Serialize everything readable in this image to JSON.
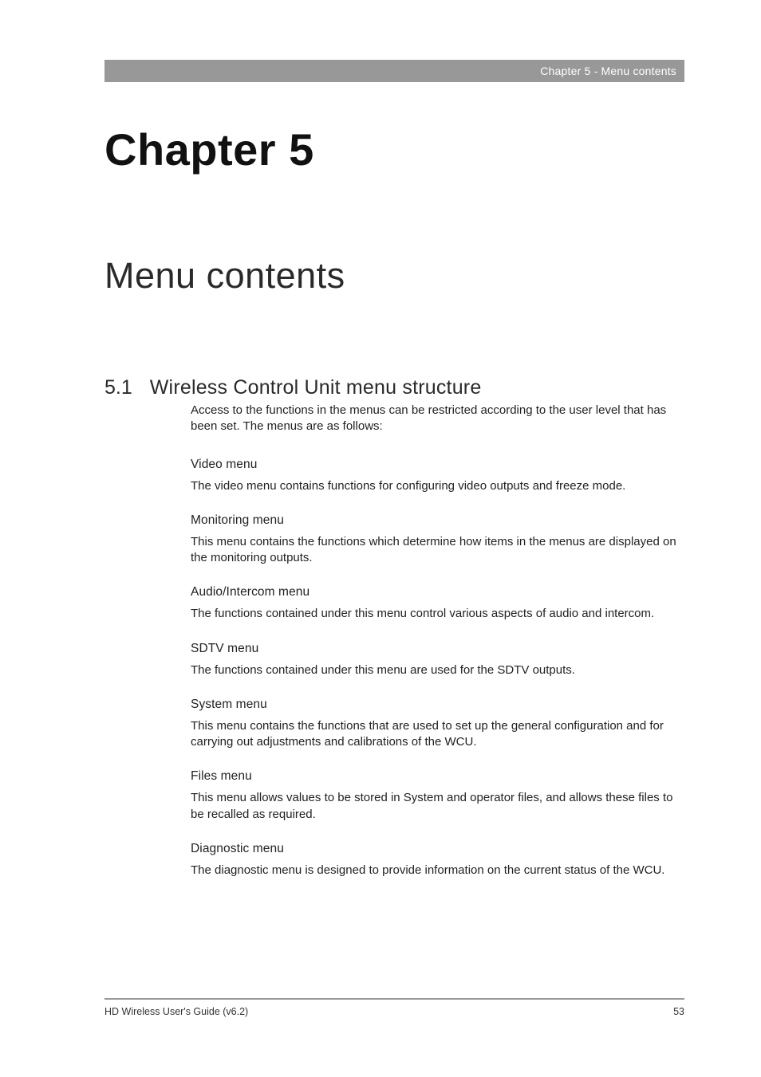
{
  "header": {
    "text": "Chapter 5 - Menu contents"
  },
  "chapter": "Chapter 5",
  "title": "Menu contents",
  "section": {
    "number": "5.1",
    "title": "Wireless Control Unit menu structure",
    "intro": "Access to the functions in the menus can be restricted according to the user level that has been set. The menus are as follows:",
    "subsections": [
      {
        "heading": "Video menu",
        "text": "The video menu contains functions for configuring video outputs and freeze mode."
      },
      {
        "heading": "Monitoring menu",
        "text": "This menu contains the functions which determine how items in the menus are displayed on the monitoring outputs."
      },
      {
        "heading": "Audio/Intercom menu",
        "text": "The functions contained under this menu control various aspects of audio and intercom."
      },
      {
        "heading": "SDTV menu",
        "text": "The functions contained under this menu are used for the SDTV outputs."
      },
      {
        "heading": "System menu",
        "text": "This menu contains the functions that are used to set up the general configuration and for carrying out adjustments and calibrations of the WCU."
      },
      {
        "heading": "Files menu",
        "text": "This menu allows values to be stored in System and operator files, and allows these files to be recalled as required."
      },
      {
        "heading": "Diagnostic menu",
        "text": "The diagnostic menu is designed to provide information on the current status of the WCU."
      }
    ]
  },
  "footer": {
    "left": "HD Wireless User's Guide (v6.2)",
    "right": "53"
  }
}
